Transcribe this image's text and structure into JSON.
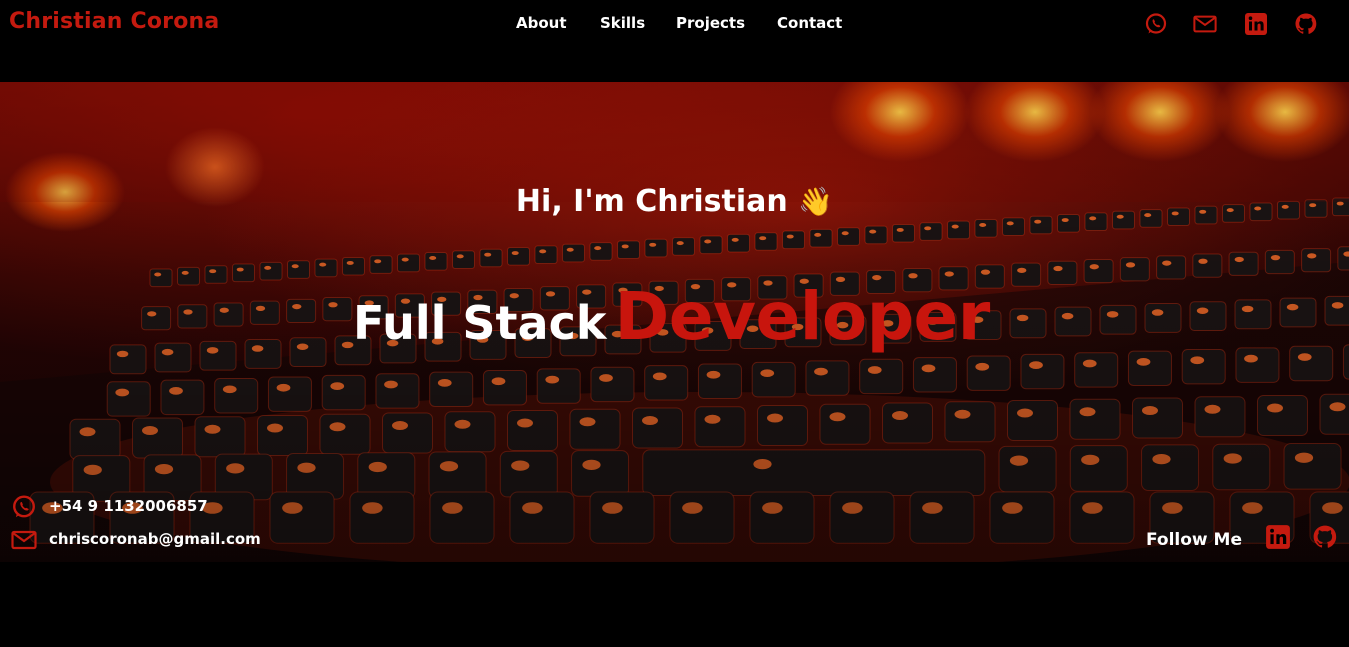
{
  "header": {
    "brand": "Christian Corona",
    "nav": [
      "About",
      "Skills",
      "Projects",
      "Contact"
    ],
    "social_icons": [
      "whatsapp-icon",
      "mail-icon",
      "linkedin-icon",
      "github-icon"
    ]
  },
  "hero": {
    "greeting": "Hi, I'm Christian",
    "greeting_emoji": "👋",
    "headline_plain": "Full Stack",
    "headline_accent": "Developer",
    "contacts": {
      "phone": "+54 9 1132006857",
      "email": "chriscoronab@gmail.com"
    },
    "follow_label": "Follow Me",
    "follow_icons": [
      "linkedin-icon",
      "github-icon"
    ]
  },
  "colors": {
    "accent": "#c41a0f",
    "background": "#000000",
    "text": "#ffffff"
  }
}
